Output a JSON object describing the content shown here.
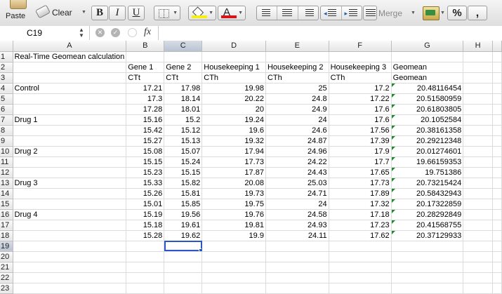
{
  "ribbon": {
    "paste_label": "Paste",
    "clear_label": "Clear",
    "bold_label": "B",
    "italic_label": "I",
    "underline_label": "U",
    "font_color_label": "A",
    "merge_label": "Merge",
    "percent_label": "%",
    "comma_label": ",",
    "fill_color": "#f4ef17",
    "font_color": "#d8141b"
  },
  "formula_bar": {
    "cell_ref": "C19",
    "fx_label": "fx",
    "formula": ""
  },
  "columns": [
    "A",
    "B",
    "C",
    "D",
    "E",
    "F",
    "G",
    "H"
  ],
  "selected_column": "C",
  "selected_row": "19",
  "rows": [
    {
      "n": "1",
      "cells": [
        "Real-Time Geomean calculation",
        "",
        "",
        "",
        "",
        "",
        "",
        ""
      ]
    },
    {
      "n": "2",
      "cells": [
        "",
        "Gene 1",
        "Gene 2",
        "Housekeeping 1",
        "Housekeeping 2",
        "Housekeeping 3",
        "Geomean",
        ""
      ]
    },
    {
      "n": "3",
      "cells": [
        "",
        "CTt",
        "CTt",
        "CTh",
        "CTh",
        "CTh",
        "Geomean",
        ""
      ]
    },
    {
      "n": "4",
      "cells": [
        "Control",
        "17.21",
        "17.98",
        "19.98",
        "25",
        "17.2",
        "20.48116454",
        ""
      ]
    },
    {
      "n": "5",
      "cells": [
        "",
        "17.3",
        "18.14",
        "20.22",
        "24.8",
        "17.22",
        "20.51580959",
        ""
      ]
    },
    {
      "n": "6",
      "cells": [
        "",
        "17.28",
        "18.01",
        "20",
        "24.9",
        "17.6",
        "20.61803805",
        ""
      ]
    },
    {
      "n": "7",
      "cells": [
        "Drug 1",
        "15.16",
        "15.2",
        "19.24",
        "24",
        "17.6",
        "20.1052584",
        ""
      ]
    },
    {
      "n": "8",
      "cells": [
        "",
        "15.42",
        "15.12",
        "19.6",
        "24.6",
        "17.56",
        "20.38161358",
        ""
      ]
    },
    {
      "n": "9",
      "cells": [
        "",
        "15.27",
        "15.13",
        "19.32",
        "24.87",
        "17.39",
        "20.29212348",
        ""
      ]
    },
    {
      "n": "10",
      "cells": [
        "Drug 2",
        "15.08",
        "15.07",
        "17.94",
        "24.96",
        "17.9",
        "20.01274601",
        ""
      ]
    },
    {
      "n": "11",
      "cells": [
        "",
        "15.15",
        "15.24",
        "17.73",
        "24.22",
        "17.7",
        "19.66159353",
        ""
      ]
    },
    {
      "n": "12",
      "cells": [
        "",
        "15.23",
        "15.15",
        "17.87",
        "24.43",
        "17.65",
        "19.751386",
        ""
      ]
    },
    {
      "n": "13",
      "cells": [
        "Drug 3",
        "15.33",
        "15.82",
        "20.08",
        "25.03",
        "17.73",
        "20.73215424",
        ""
      ]
    },
    {
      "n": "14",
      "cells": [
        "",
        "15.26",
        "15.81",
        "19.73",
        "24.71",
        "17.89",
        "20.58432943",
        ""
      ]
    },
    {
      "n": "15",
      "cells": [
        "",
        "15.01",
        "15.85",
        "19.75",
        "24",
        "17.32",
        "20.17322859",
        ""
      ]
    },
    {
      "n": "16",
      "cells": [
        "Drug 4",
        "15.19",
        "19.56",
        "19.76",
        "24.58",
        "17.18",
        "20.28292849",
        ""
      ]
    },
    {
      "n": "17",
      "cells": [
        "",
        "15.18",
        "19.61",
        "19.81",
        "24.93",
        "17.23",
        "20.41568755",
        ""
      ]
    },
    {
      "n": "18",
      "cells": [
        "",
        "15.28",
        "19.62",
        "19.9",
        "24.11",
        "17.62",
        "20.37129933",
        ""
      ]
    },
    {
      "n": "19",
      "cells": [
        "",
        "",
        "",
        "",
        "",
        "",
        "",
        ""
      ]
    },
    {
      "n": "20",
      "cells": [
        "",
        "",
        "",
        "",
        "",
        "",
        "",
        ""
      ]
    },
    {
      "n": "21",
      "cells": [
        "",
        "",
        "",
        "",
        "",
        "",
        "",
        ""
      ]
    },
    {
      "n": "22",
      "cells": [
        "",
        "",
        "",
        "",
        "",
        "",
        "",
        ""
      ]
    },
    {
      "n": "23",
      "cells": [
        "",
        "",
        "",
        "",
        "",
        "",
        "",
        ""
      ]
    }
  ]
}
